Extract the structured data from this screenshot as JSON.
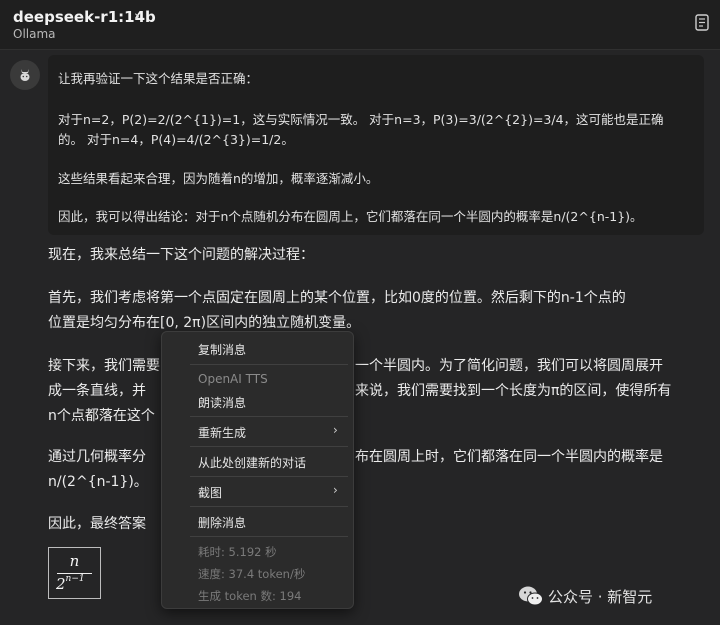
{
  "header": {
    "model_name": "deepseek-r1:14b",
    "model_chevron": "›",
    "provider": "Ollama"
  },
  "thinking": {
    "lines": [
      "让我再验证一下这个结果是否正确：",
      "对于n=2，P(2)=2/(2^{1})=1，这与实际情况一致。 对于n=3，P(3)=3/(2^{2})=3/4，这可能也是正确",
      "的。 对于n=4，P(4)=4/(2^{3})=1/2。",
      "这些结果看起来合理，因为随着n的增加，概率逐渐减小。",
      "因此，我可以得出结论：对于n个点随机分布在圆周上，它们都落在同一个半圆内的概率是n/(2^{n-1})。"
    ]
  },
  "answer": {
    "p1": "现在，我来总结一下这个问题的解决过程：",
    "p2_line1": "首先，我们考虑将第一个点固定在圆周上的某个位置，比如0度的位置。然后剩下的n-1个点的",
    "p2_line2": "位置是均匀分布在[0, 2π)区间内的独立随机变量。",
    "p3_line1_start": "接下来，我们需要",
    "p3_line1_end": "一个半圆内。为了简化问题，我们可以将圆周展开",
    "p3_line2_start": "成一条直线，并",
    "p3_line2_end": "来说，我们需要找到一个长度为π的区间，使得所有",
    "p3_line3_start": "n个点都落在这个",
    "p4_line1_start": "通过几何概率分",
    "p4_line1_end": "布在圆周上时，它们都落在同一个半圆内的概率是",
    "p4_line2": "n/(2^{n-1})。",
    "p5_start": "因此，最终答案",
    "formula": {
      "numerator": "n",
      "denominator_base": "2",
      "denominator_exp": "n−1"
    }
  },
  "context_menu": {
    "copy": "复制消息",
    "tts_header": "OpenAI TTS",
    "read_aloud": "朗读消息",
    "regenerate": "重新生成",
    "new_chat_from_here": "从此处创建新的对话",
    "screenshot": "截图",
    "delete": "删除消息",
    "elapsed": "耗时: 5.192 秒",
    "speed": "速度: 37.4 token/秒",
    "tokens": "生成 token 数: 194",
    "submenu_arrow": "›"
  },
  "watermark": {
    "text": "公众号 · 新智元"
  }
}
